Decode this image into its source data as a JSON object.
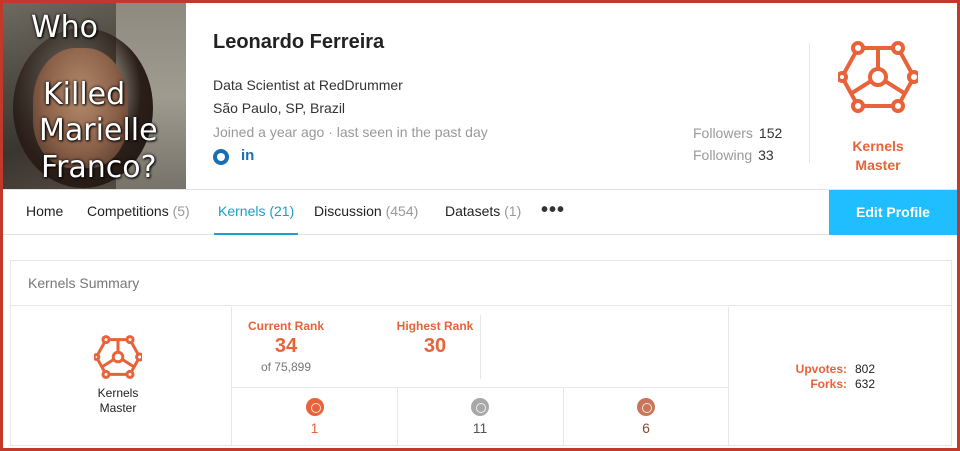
{
  "profile": {
    "photo_overlay": [
      "Who",
      "Killed",
      "Marielle",
      "Franco?"
    ],
    "name": "Leonardo Ferreira",
    "occupation": "Data Scientist at RedDrummer",
    "location": "São Paulo, SP, Brazil",
    "activity": "Joined a year ago · last seen in the past day",
    "social_icons": [
      "github-icon",
      "linkedin-icon"
    ],
    "linkedin_glyph": "in",
    "followers_label": "Followers",
    "followers_count": "152",
    "following_label": "Following",
    "following_count": "33",
    "tier_line1": "Kernels",
    "tier_line2": "Master"
  },
  "nav": {
    "tabs": [
      {
        "label": "Home",
        "count": ""
      },
      {
        "label": "Competitions",
        "count": "(5)"
      },
      {
        "label": "Kernels",
        "count": "(21)"
      },
      {
        "label": "Discussion",
        "count": "(454)"
      },
      {
        "label": "Datasets",
        "count": "(1)"
      }
    ],
    "active_tab": "Kernels",
    "more": "•••",
    "edit_profile": "Edit Profile"
  },
  "summary": {
    "title": "Kernels Summary",
    "tier_line1": "Kernels",
    "tier_line2": "Master",
    "current_rank_label": "Current Rank",
    "current_rank": "34",
    "current_rank_of": "of 75,899",
    "highest_rank_label": "Highest Rank",
    "highest_rank": "30",
    "medals": [
      {
        "type": "gold",
        "count": "1"
      },
      {
        "type": "silver",
        "count": "11"
      },
      {
        "type": "bronze",
        "count": "6"
      }
    ],
    "upvotes_label": "Upvotes:",
    "upvotes": "802",
    "forks_label": "Forks:",
    "forks": "632"
  },
  "colors": {
    "accent_orange": "#e8623a",
    "active_tab_blue": "#1a9fc8",
    "button_blue": "#20beff",
    "gold_medal": "#e8623a",
    "silver_medal": "#a8a8a8",
    "bronze_medal": "#c8765a",
    "frame_red": "#c0392b"
  }
}
